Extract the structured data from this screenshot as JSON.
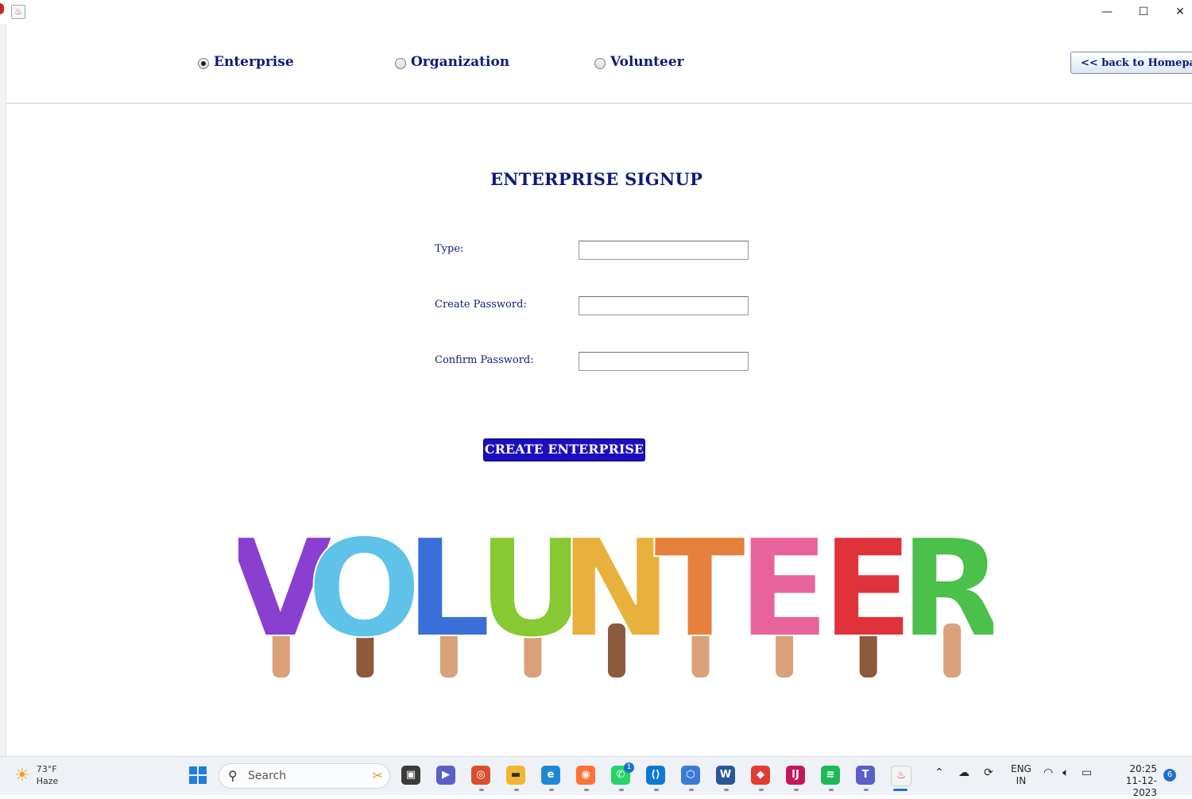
{
  "window": {
    "minimize_glyph": "—",
    "maximize_glyph": "☐",
    "close_glyph": "✕"
  },
  "header": {
    "radio_options": [
      {
        "label": "Enterprise",
        "selected": true
      },
      {
        "label": "Organization",
        "selected": false
      },
      {
        "label": "Volunteer",
        "selected": false
      }
    ],
    "back_button_label": "<< back to Homepage"
  },
  "form": {
    "title": "ENTERPRISE SIGNUP",
    "fields": [
      {
        "label": "Type:",
        "value": ""
      },
      {
        "label": "Create Password:",
        "value": ""
      },
      {
        "label": "Confirm Password:",
        "value": ""
      }
    ],
    "submit_label": "CREATE ENTERPRISE"
  },
  "banner": {
    "letters": [
      "V",
      "O",
      "L",
      "U",
      "N",
      "T",
      "E",
      "E",
      "R"
    ],
    "colors": [
      "#8a3fd1",
      "#5fc2e8",
      "#3a6fd8",
      "#86c932",
      "#e7b13b",
      "#e5813c",
      "#e8629b",
      "#e0323b",
      "#4bc04a"
    ]
  },
  "taskbar": {
    "weather_temp": "73°F",
    "weather_desc": "Haze",
    "search_placeholder": "Search",
    "whatsapp_badge": "1",
    "lang_line1": "ENG",
    "lang_line2": "IN",
    "time": "20:25",
    "date": "11-12-2023",
    "notification_count": "6"
  },
  "colors": {
    "accent_text": "#0b1a7a",
    "button_bg": "#1a0fc0"
  }
}
